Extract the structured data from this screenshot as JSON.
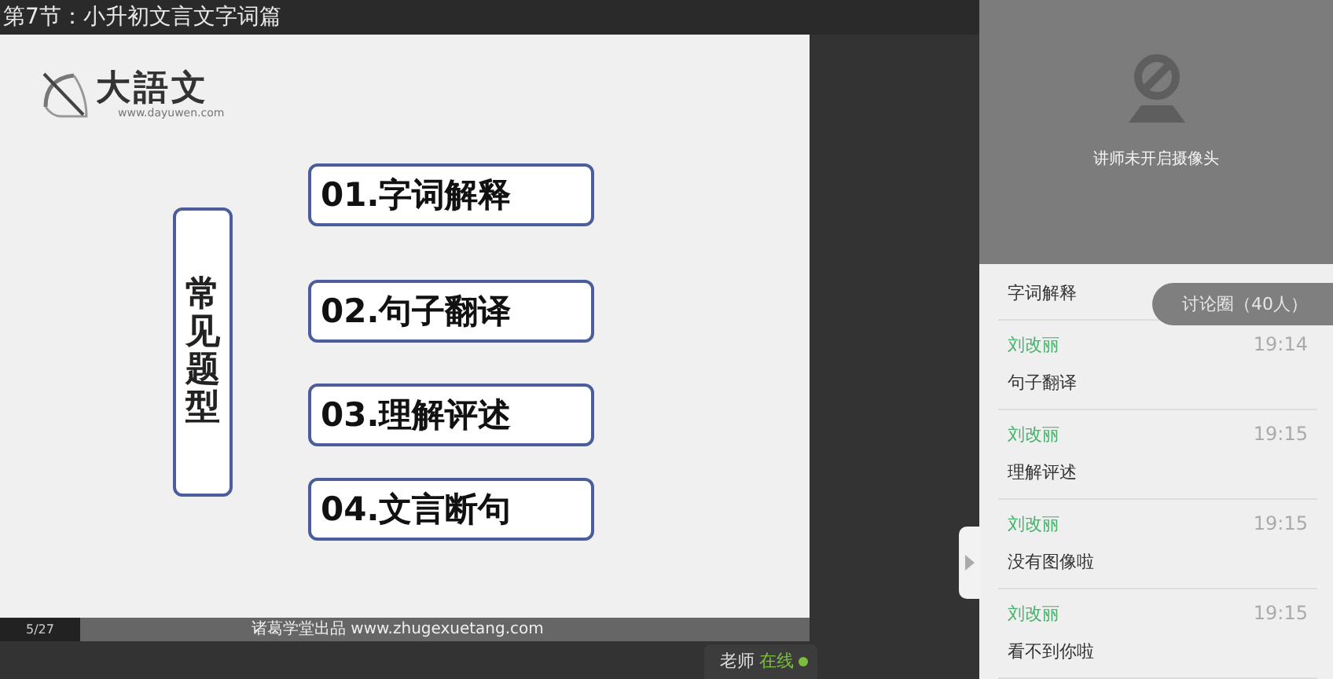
{
  "window": {
    "title": "第7节：小升初文言文字词篇"
  },
  "slide": {
    "logo": {
      "name": "大語文",
      "url": "www.dayuwen.com"
    },
    "heading": "常见题型",
    "items": [
      "01.字词解释",
      "02.句子翻译",
      "03.理解评述",
      "04.文言断句"
    ],
    "page": "5/27",
    "footer": "诸葛学堂出品 www.zhugexuetang.com"
  },
  "teacher_status": {
    "label": "老师",
    "status": "在线",
    "online": true
  },
  "video": {
    "message": "讲师未开启摄像头"
  },
  "chat": {
    "room_button": "讨论圈（40人）",
    "messages": [
      {
        "text": "字词解释"
      },
      {
        "name": "刘改丽",
        "time": "19:14",
        "text": "句子翻译"
      },
      {
        "name": "刘改丽",
        "time": "19:15",
        "text": "理解评述"
      },
      {
        "name": "刘改丽",
        "time": "19:15",
        "text": "没有图像啦"
      },
      {
        "name": "刘改丽",
        "time": "19:15",
        "text": "看不到你啦"
      }
    ]
  }
}
